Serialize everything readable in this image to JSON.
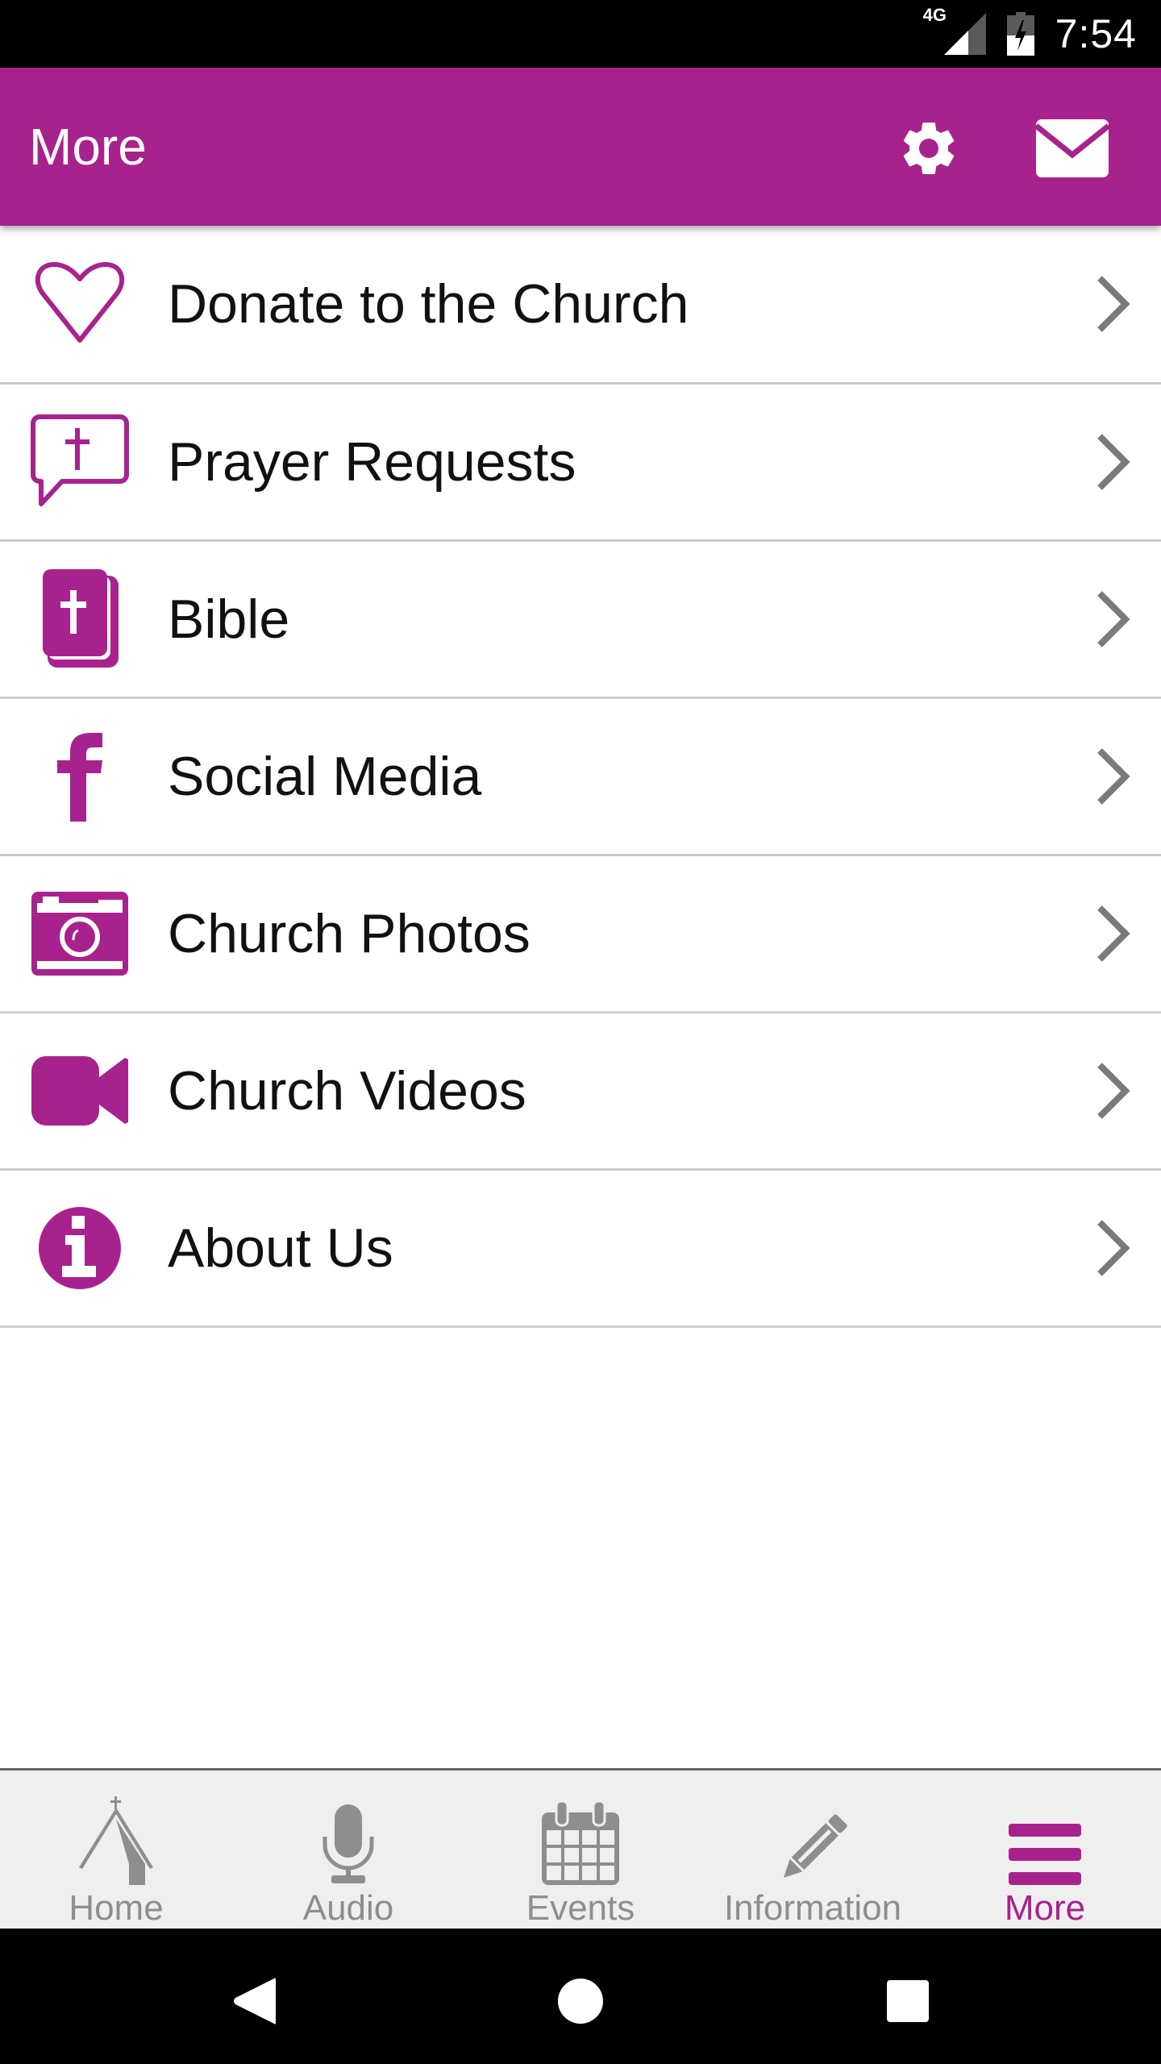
{
  "status_bar": {
    "network": "4G",
    "time": "7:54",
    "icons": [
      "signal-icon",
      "battery-charging-icon"
    ]
  },
  "app_bar": {
    "title": "More",
    "actions": [
      {
        "name": "settings",
        "icon": "gear-icon"
      },
      {
        "name": "messages",
        "icon": "envelope-icon"
      }
    ]
  },
  "menu": {
    "items": [
      {
        "label": "Donate to the Church",
        "icon": "heart-icon"
      },
      {
        "label": "Prayer Requests",
        "icon": "prayer-speech-bubble-icon"
      },
      {
        "label": "Bible",
        "icon": "bible-icon"
      },
      {
        "label": "Social Media",
        "icon": "facebook-icon"
      },
      {
        "label": "Church Photos",
        "icon": "camera-icon"
      },
      {
        "label": "Church Videos",
        "icon": "video-camera-icon"
      },
      {
        "label": "About Us",
        "icon": "info-icon"
      }
    ]
  },
  "tabs": {
    "items": [
      {
        "label": "Home",
        "icon": "church-icon",
        "active": false
      },
      {
        "label": "Audio",
        "icon": "microphone-icon",
        "active": false
      },
      {
        "label": "Events",
        "icon": "calendar-icon",
        "active": false
      },
      {
        "label": "Information",
        "icon": "pencil-icon",
        "active": false
      },
      {
        "label": "More",
        "icon": "hamburger-menu-icon",
        "active": true
      }
    ]
  },
  "nav_bar": {
    "buttons": [
      "back",
      "home",
      "recents"
    ]
  },
  "colors": {
    "brand": "#A8228E",
    "inactive_tab": "#8E8E8E",
    "chevron": "#7A7A7A",
    "divider": "#CCCCCC"
  }
}
